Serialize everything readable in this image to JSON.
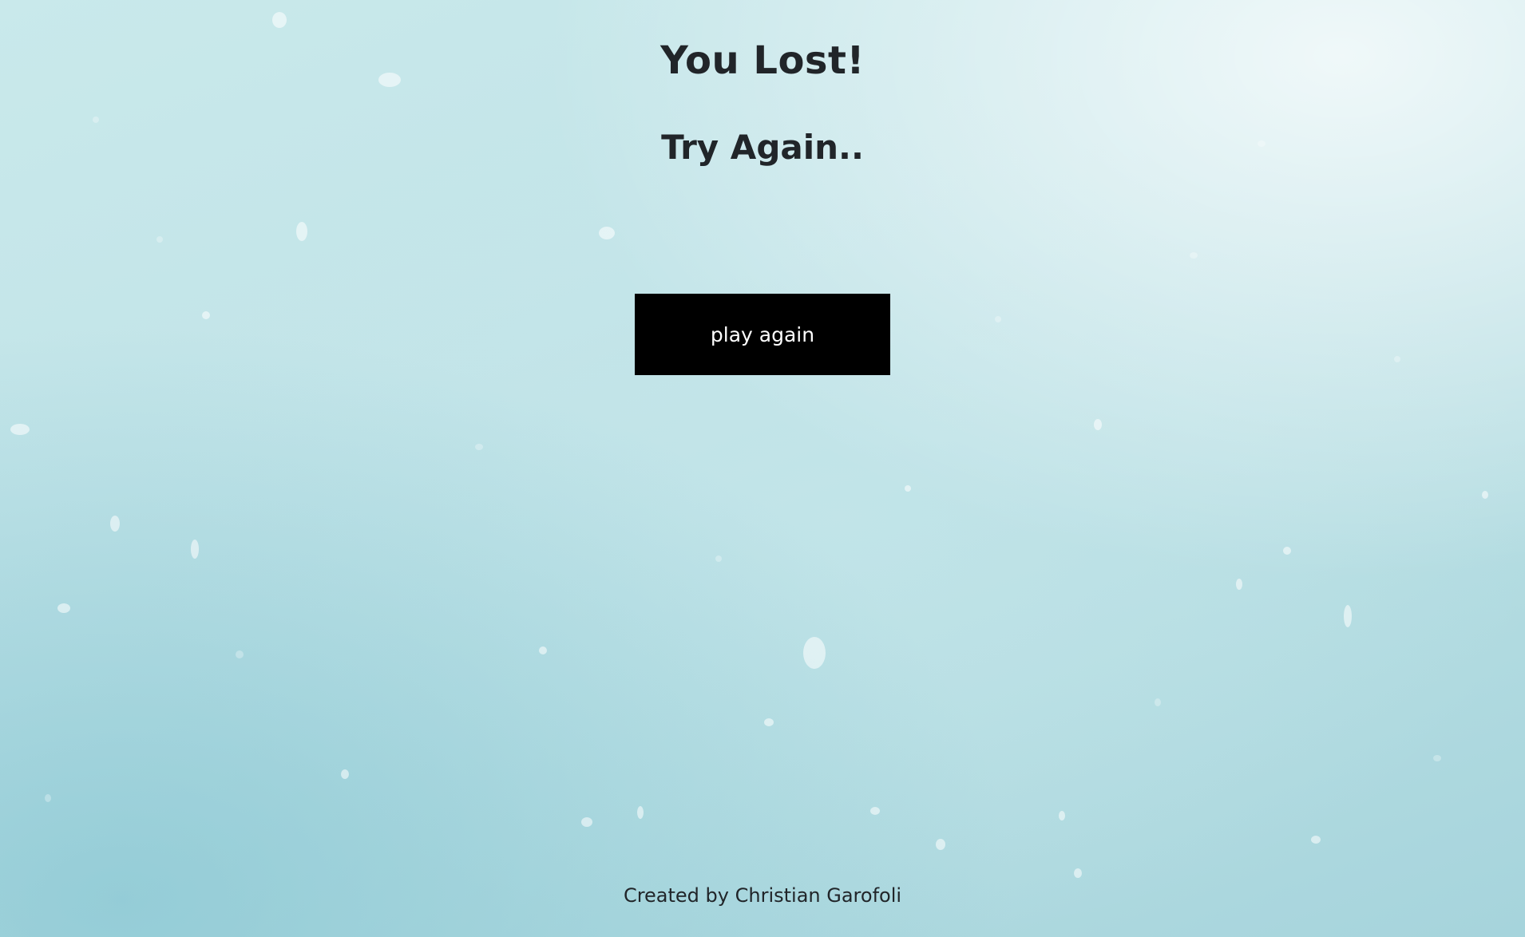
{
  "game_over": {
    "title": "You Lost!",
    "subtitle": "Try Again..",
    "play_again_label": "play again"
  },
  "footer": {
    "credit": "Created by Christian Garofoli"
  },
  "colors": {
    "button_background": "#000000",
    "button_text": "#ffffff",
    "text": "#212529",
    "background": "#c2e4e8"
  }
}
